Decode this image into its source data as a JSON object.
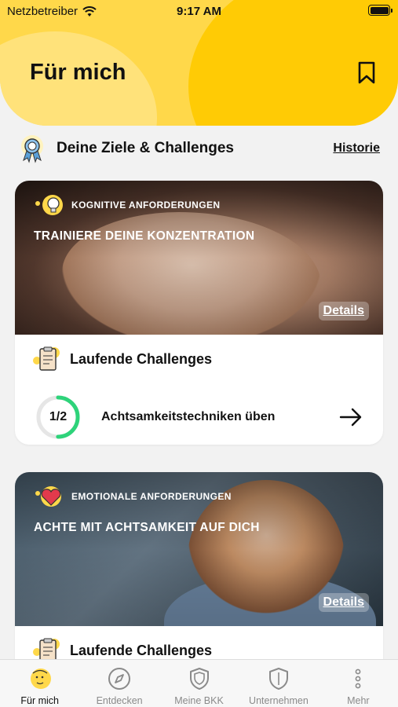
{
  "status_bar": {
    "carrier": "Netzbetreiber",
    "time": "9:17 AM"
  },
  "header": {
    "title": "Für mich"
  },
  "goals": {
    "title": "Deine Ziele & Challenges",
    "history_link": "Historie"
  },
  "cards": [
    {
      "category": "KOGNITIVE ANFORDERUNGEN",
      "title": "TRAINIERE DEINE KONZENTRATION",
      "details": "Details",
      "running_label": "Laufende Challenges",
      "challenge": {
        "progress": "1/2",
        "progress_fraction": 0.5,
        "name": "Achtsamkeitstechniken üben"
      }
    },
    {
      "category": "EMOTIONALE ANFORDERUNGEN",
      "title": "ACHTE MIT ACHTSAMKEIT AUF DICH",
      "details": "Details",
      "running_label": "Laufende Challenges"
    }
  ],
  "tabs": [
    {
      "label": "Für mich",
      "icon": "face-icon",
      "active": true
    },
    {
      "label": "Entdecken",
      "icon": "compass-icon",
      "active": false
    },
    {
      "label": "Meine BKK",
      "icon": "shield-icon",
      "active": false
    },
    {
      "label": "Unternehmen",
      "icon": "shield-outline-icon",
      "active": false
    },
    {
      "label": "Mehr",
      "icon": "more-vertical-icon",
      "active": false
    }
  ],
  "colors": {
    "accent": "#ffcb05",
    "progress": "#2ed37a"
  }
}
